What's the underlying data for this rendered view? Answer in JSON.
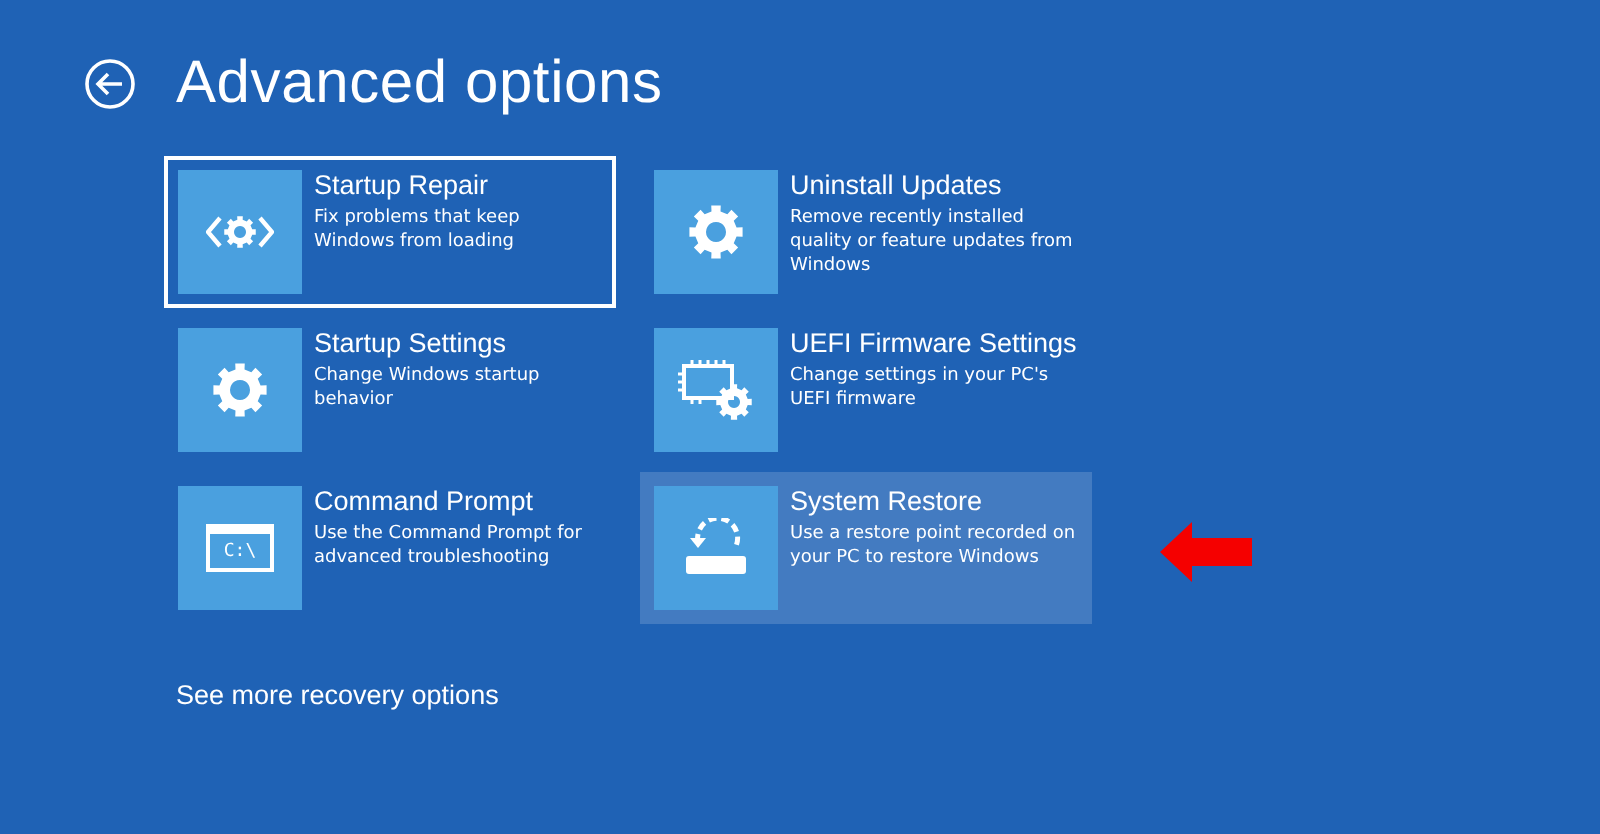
{
  "title": "Advanced options",
  "options": [
    {
      "title": "Startup Repair",
      "description": "Fix problems that keep Windows from loading",
      "kind": "repair",
      "focused": true,
      "highlighted": false
    },
    {
      "title": "Uninstall Updates",
      "description": "Remove recently installed quality or feature updates from Windows",
      "kind": "gear",
      "focused": false,
      "highlighted": false
    },
    {
      "title": "Startup Settings",
      "description": "Change Windows startup behavior",
      "kind": "gear",
      "focused": false,
      "highlighted": false
    },
    {
      "title": "UEFI Firmware Settings",
      "description": "Change settings in your PC's UEFI firmware",
      "kind": "chip",
      "focused": false,
      "highlighted": false
    },
    {
      "title": "Command Prompt",
      "description": "Use the Command Prompt for advanced troubleshooting",
      "kind": "console",
      "icon_text": "C:\\",
      "focused": false,
      "highlighted": false
    },
    {
      "title": "System Restore",
      "description": "Use a restore point recorded on your PC to restore Windows",
      "kind": "restore",
      "focused": false,
      "highlighted": true
    }
  ],
  "more_link": "See more recovery options"
}
